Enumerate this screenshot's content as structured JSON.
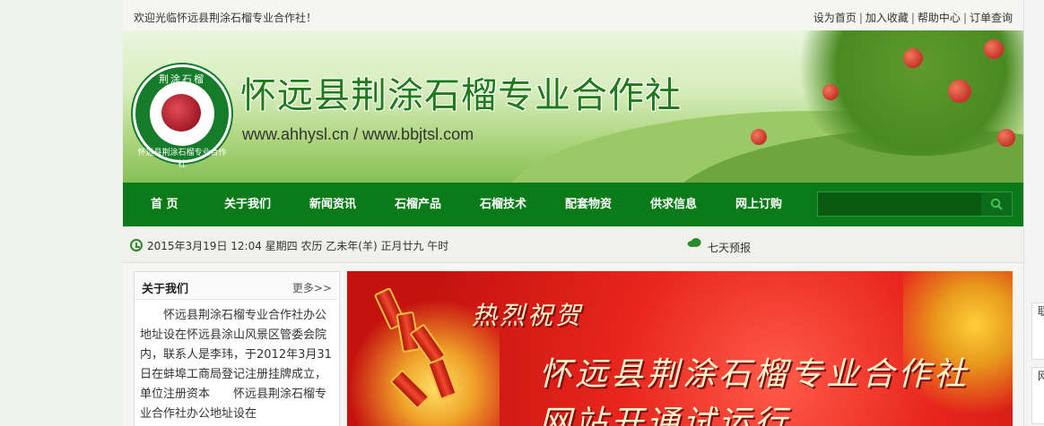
{
  "topbar": {
    "welcome": "欢迎光临怀远县荆涂石榴专业合作社！",
    "links": [
      "设为首页",
      "加入收藏",
      "帮助中心",
      "订单查询"
    ]
  },
  "banner": {
    "logo_text_top": "荆涂石榴",
    "logo_text_bottom": "怀远县荆涂石榴专业合作社",
    "title": "怀远县荆涂石榴专业合作社",
    "url": "www.ahhysl.cn / www.bbjtsl.com"
  },
  "nav": {
    "items": [
      "首 页",
      "关于我们",
      "新闻资讯",
      "石榴产品",
      "石榴技术",
      "配套物资",
      "供求信息",
      "网上订购"
    ],
    "search_value": ""
  },
  "infobar": {
    "datetime": "2015年3月19日 12:04 星期四 农历 乙未年(羊) 正月廿九 午时",
    "forecast": "七天预报"
  },
  "about": {
    "title": "关于我们",
    "more": "更多>>",
    "text": "怀远县荆涂石榴专业合作社办公地址设在怀远县涂山风景区管委会院内，联系人是李玮，于2012年3月31日在蚌埠工商局登记注册挂牌成立，单位注册资本　　怀远县荆涂石榴专业合作社办公地址设在"
  },
  "slide": {
    "line1": "热烈祝贺",
    "line2": "怀远县荆涂石榴专业合作社",
    "line3": "网站开通试运行"
  },
  "right_edge": {
    "chips": [
      "联",
      "网"
    ]
  },
  "colors": {
    "nav_green": "#0b7a18",
    "title_green": "#1f7a1a",
    "slide_red": "#e8261d"
  }
}
